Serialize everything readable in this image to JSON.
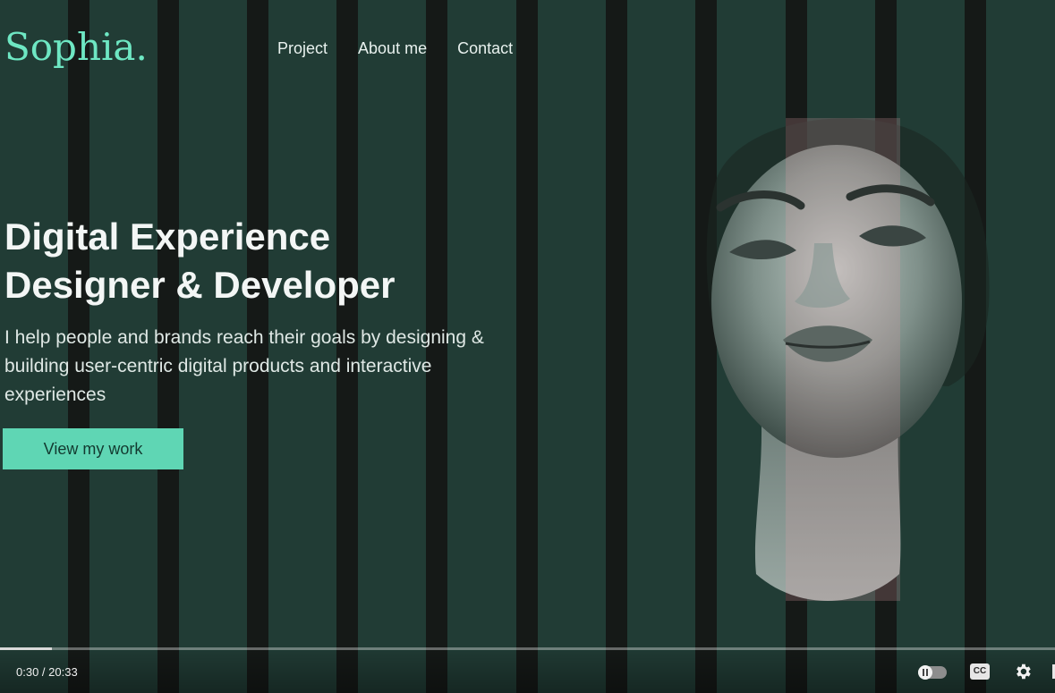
{
  "site": {
    "logo": "Sophia.",
    "nav": [
      "Project",
      "About me",
      "Contact"
    ]
  },
  "hero": {
    "headline_line1": "Digital Experience",
    "headline_line2": "Designer & Developer",
    "subtitle": "I help people and brands reach their goals by designing & building user-centric digital products and interactive experiences",
    "cta_label": "View my work"
  },
  "player": {
    "current_time": "0:30",
    "duration": "20:33",
    "time_display": "0:30 / 20:33",
    "progress_fraction": 0.049,
    "cc_label": "CC",
    "icons": [
      "autoplay-toggle-icon",
      "captions-icon",
      "settings-gear-icon"
    ]
  },
  "colors": {
    "background": "#213c35",
    "accent": "#6ee7c3",
    "button": "#5fd6b4",
    "stripes": "#141514"
  }
}
